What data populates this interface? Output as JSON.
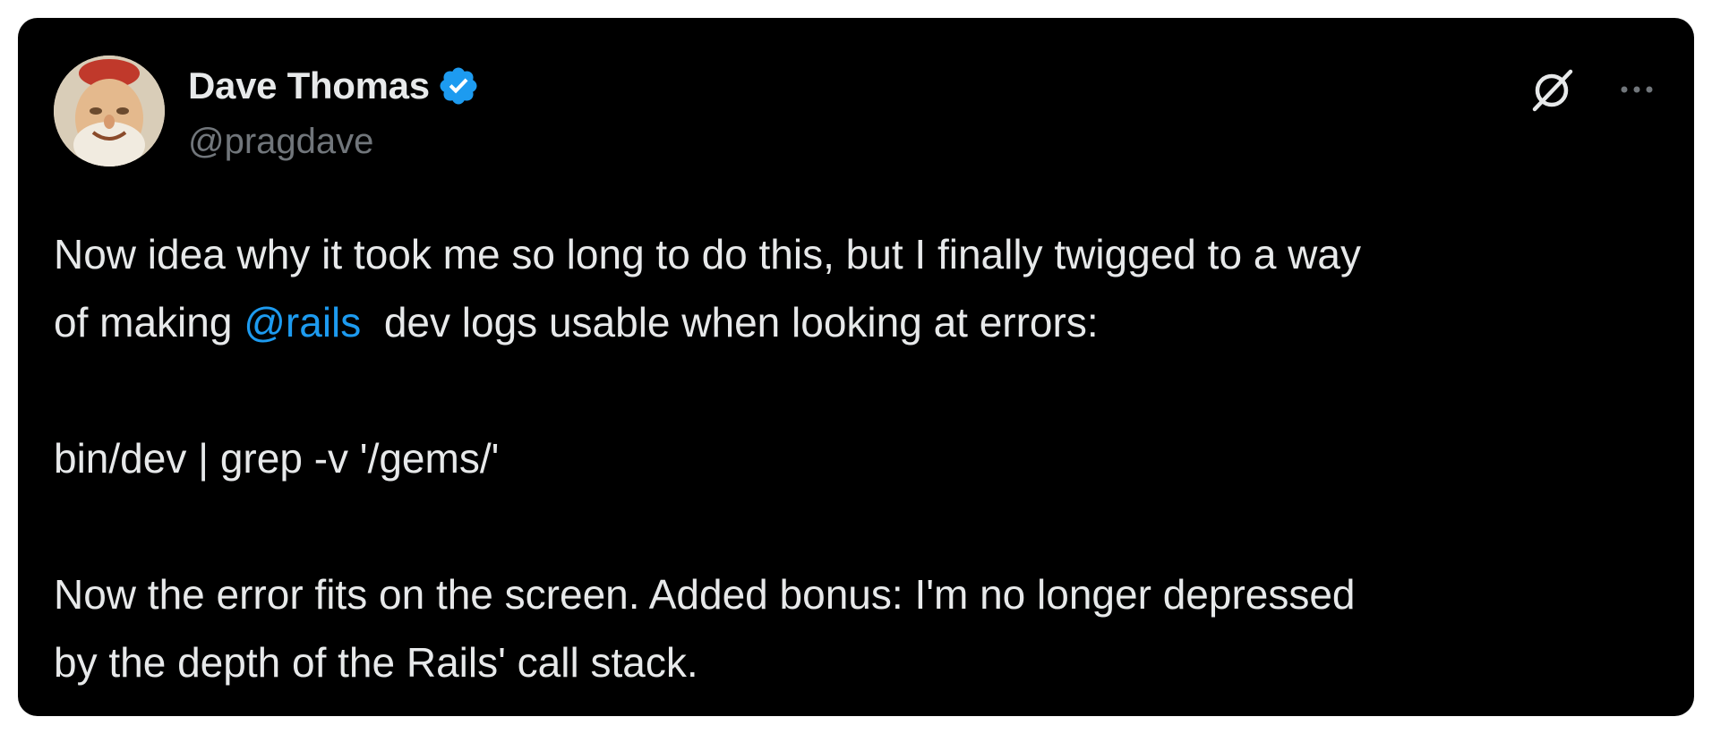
{
  "author": {
    "display_name": "Dave Thomas",
    "handle": "@pragdave",
    "verified": true,
    "avatar_icon": "avatar-image"
  },
  "actions": {
    "grok_icon": "grok-icon",
    "more_icon": "more-options-icon"
  },
  "tweet": {
    "line1_prefix": "Now idea why it took me so long to do this, but I finally twigged to a way",
    "line2_prefix": "of making ",
    "mention": "@rails",
    "line2_suffix": "  dev logs usable when looking at errors:",
    "command": "bin/dev | grep -v '/gems/'",
    "line5": "Now the error fits on the screen. Added bonus: I'm no longer depressed",
    "line6": "by the depth of the Rails' call stack."
  },
  "colors": {
    "background": "#000000",
    "text": "#e7e9ea",
    "handle": "#71767b",
    "link": "#1d9bf0",
    "verified_badge": "#1d9bf0"
  }
}
